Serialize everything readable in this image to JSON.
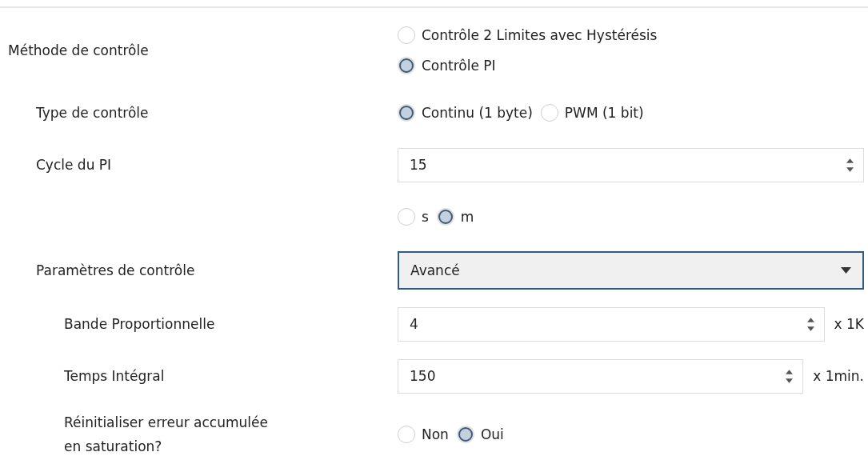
{
  "rows": [
    {
      "label": "Méthode de contrôle",
      "kind": "radiostack",
      "options": [
        {
          "label": "Contrôle 2 Limites avec Hystérésis",
          "selected": false
        },
        {
          "label": "Contrôle PI",
          "selected": true
        }
      ],
      "children": [
        {
          "label": "Type de contrôle",
          "kind": "radio",
          "options": [
            {
              "label": "Continu (1 byte)",
              "selected": true
            },
            {
              "label": "PWM (1 bit)",
              "selected": false
            }
          ]
        },
        {
          "label": "Cycle du PI",
          "kind": "spin",
          "value": "15"
        },
        {
          "kind": "radio",
          "options": [
            {
              "label": "s",
              "selected": false
            },
            {
              "label": "m",
              "selected": true
            }
          ]
        },
        {
          "label": "Paramètres de contrôle",
          "kind": "dropdown",
          "value": "Avancé",
          "focused": true,
          "children": [
            {
              "label": "Bande Proportionnelle",
              "kind": "spin",
              "value": "4",
              "unit": "x 1K"
            },
            {
              "label": "Temps Intégral",
              "kind": "spin",
              "value": "150",
              "unit": "x 1min."
            },
            {
              "label": "Réinitialiser erreur accumulée en saturation?",
              "kind": "radio",
              "options": [
                {
                  "label": "Non",
                  "selected": false
                },
                {
                  "label": "Oui",
                  "selected": true
                }
              ]
            }
          ]
        }
      ]
    }
  ]
}
